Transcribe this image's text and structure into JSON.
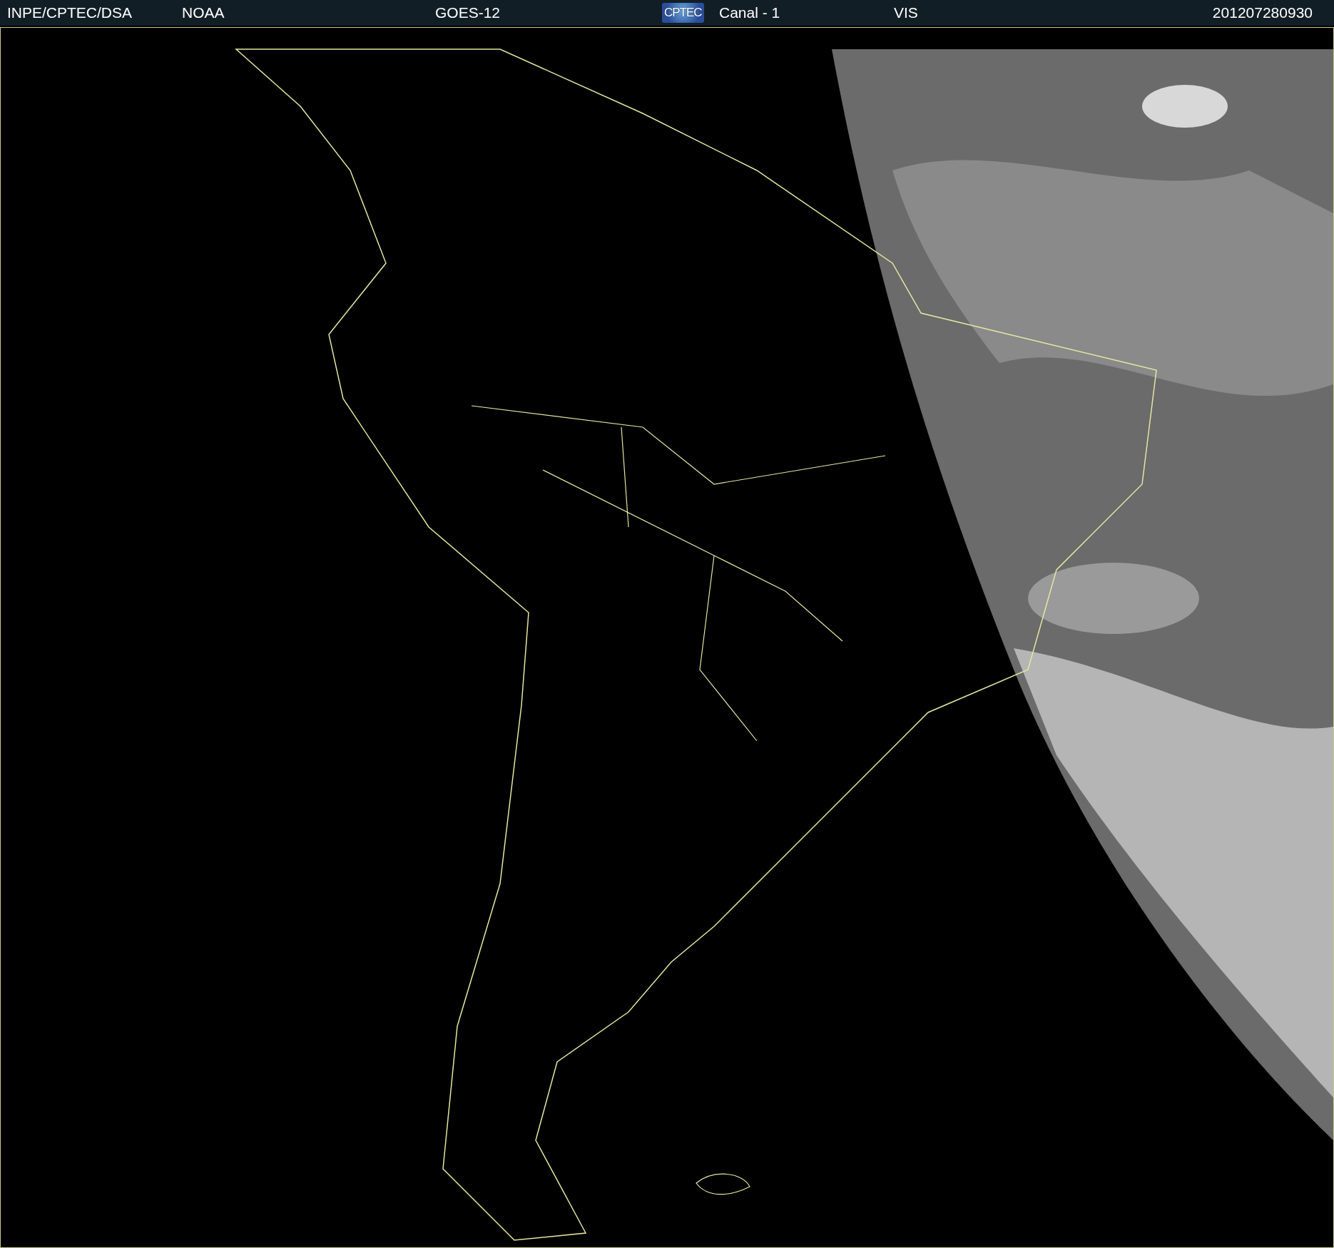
{
  "header": {
    "source": "INPE/CPTEC/DSA",
    "agency": "NOAA",
    "satellite": "GOES-12",
    "logo": "CPTEC",
    "channel": "Canal - 1",
    "band": "VIS",
    "timestamp": "201207280930"
  }
}
